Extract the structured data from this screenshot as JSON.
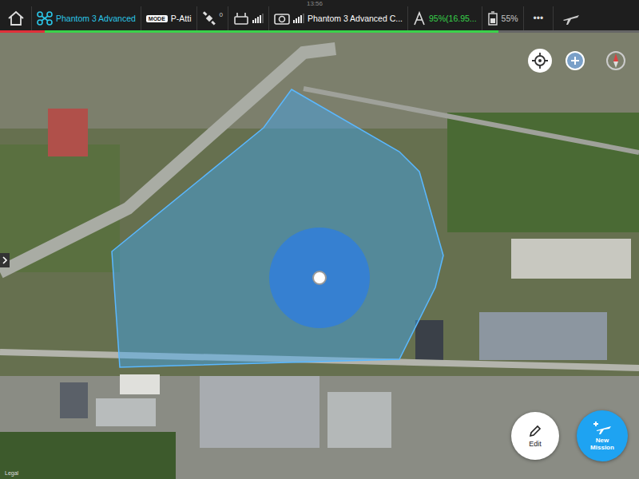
{
  "status_bar": {
    "time": "13:56"
  },
  "top_bar": {
    "aircraft": "Phantom 3 Advanced",
    "mode_badge": "MODE",
    "mode": "P-Atti",
    "satellites": "0",
    "camera": "Phantom 3 Advanced C...",
    "aircraft_battery": "95%(16.95...",
    "remote_battery": "55%",
    "more": "•••",
    "remote_signal": {
      "level": 0.8
    },
    "video_signal": {
      "level": 0.8
    }
  },
  "battery_gauge": {
    "level": 0.78,
    "warning_level": 0.07
  },
  "map": {
    "attribution": "Legal"
  },
  "buttons": [
    {
      "label": "Edit"
    },
    {
      "label": "New Mission"
    }
  ]
}
